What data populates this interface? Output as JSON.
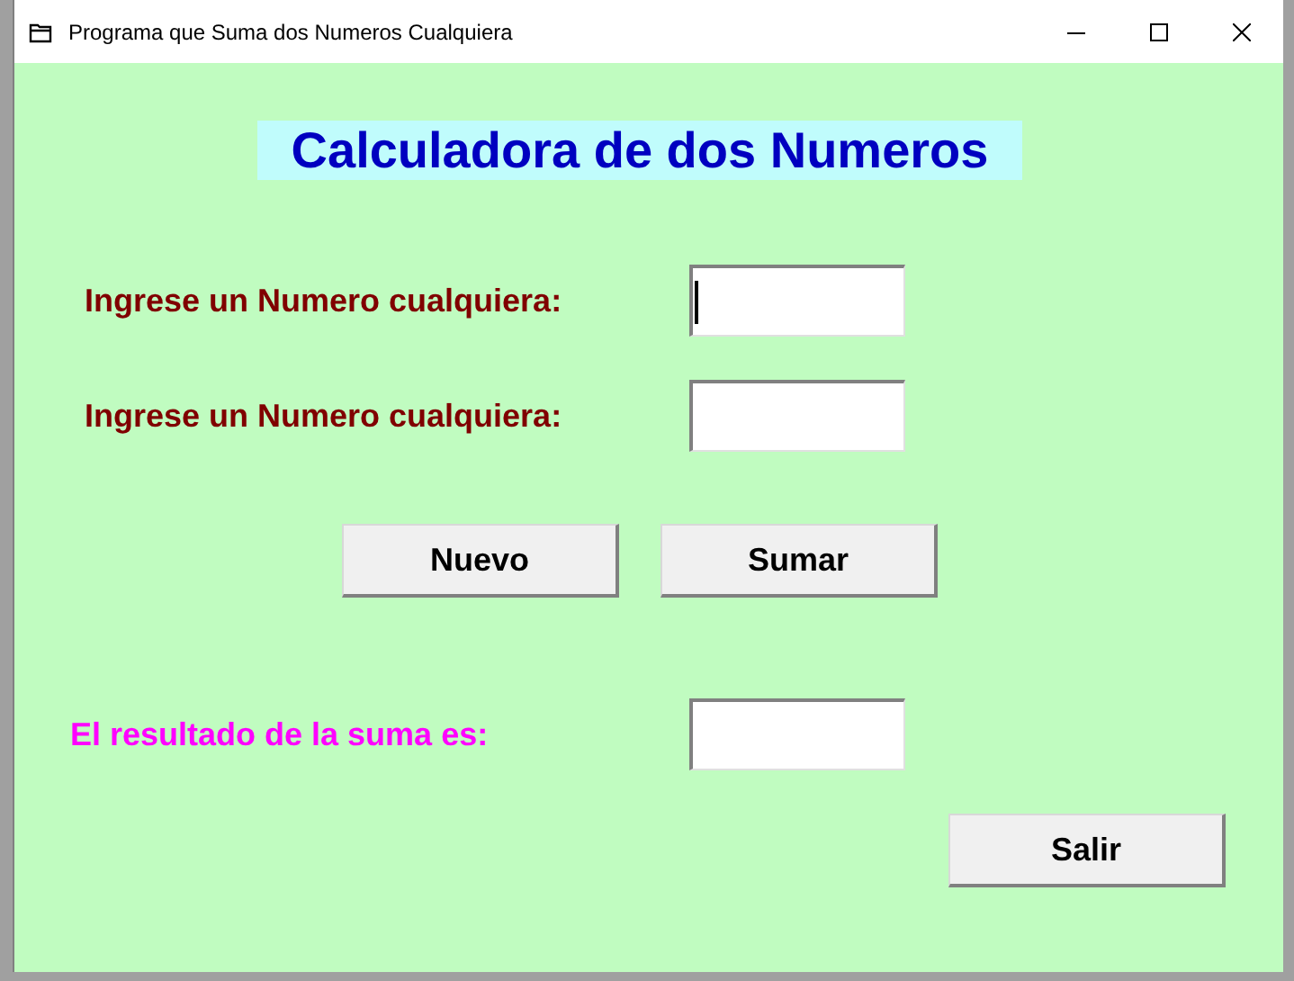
{
  "window": {
    "title": "Programa que Suma dos Numeros Cualquiera"
  },
  "heading": "Calculadora de dos Numeros",
  "inputs": [
    {
      "label": "Ingrese un Numero cualquiera:",
      "focused": true
    },
    {
      "label": "Ingrese un Numero cualquiera:",
      "focused": false
    }
  ],
  "buttons": [
    "Nuevo",
    "Sumar"
  ],
  "result": {
    "label": "El resultado de la suma es:"
  },
  "exit_button": "Salir"
}
